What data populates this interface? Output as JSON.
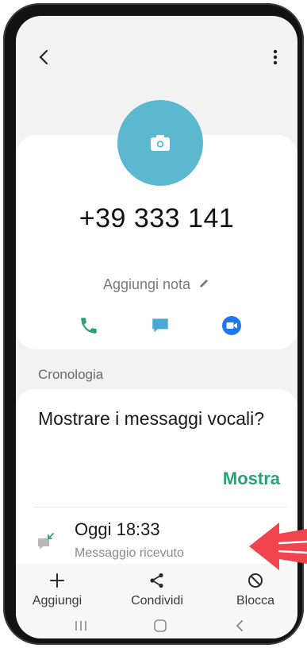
{
  "header": {
    "back_icon": "back-arrow-icon",
    "more_icon": "more-vertical-icon"
  },
  "contact": {
    "avatar_icon": "camera-icon",
    "phone_number": "+39 333 141",
    "add_note_label": "Aggiungi nota",
    "actions": [
      {
        "name": "call",
        "icon": "phone-icon",
        "color": "#2aa178"
      },
      {
        "name": "message",
        "icon": "message-icon",
        "color": "#4aa8d8"
      },
      {
        "name": "video",
        "icon": "video-icon",
        "color": "#1f78f0"
      }
    ]
  },
  "history": {
    "section_label": "Cronologia",
    "voicemail_prompt": "Mostrare i messaggi vocali?",
    "show_label": "Mostra",
    "entry": {
      "time": "Oggi 18:33",
      "subtitle": "Messaggio ricevuto",
      "icon": "incoming-message-icon"
    }
  },
  "bottom_bar": {
    "add_label": "Aggiungi",
    "share_label": "Condividi",
    "block_label": "Blocca"
  },
  "colors": {
    "accent_green": "#2aa178",
    "avatar_bg": "#5cb8cf",
    "annotation_arrow": "#f0454f"
  }
}
